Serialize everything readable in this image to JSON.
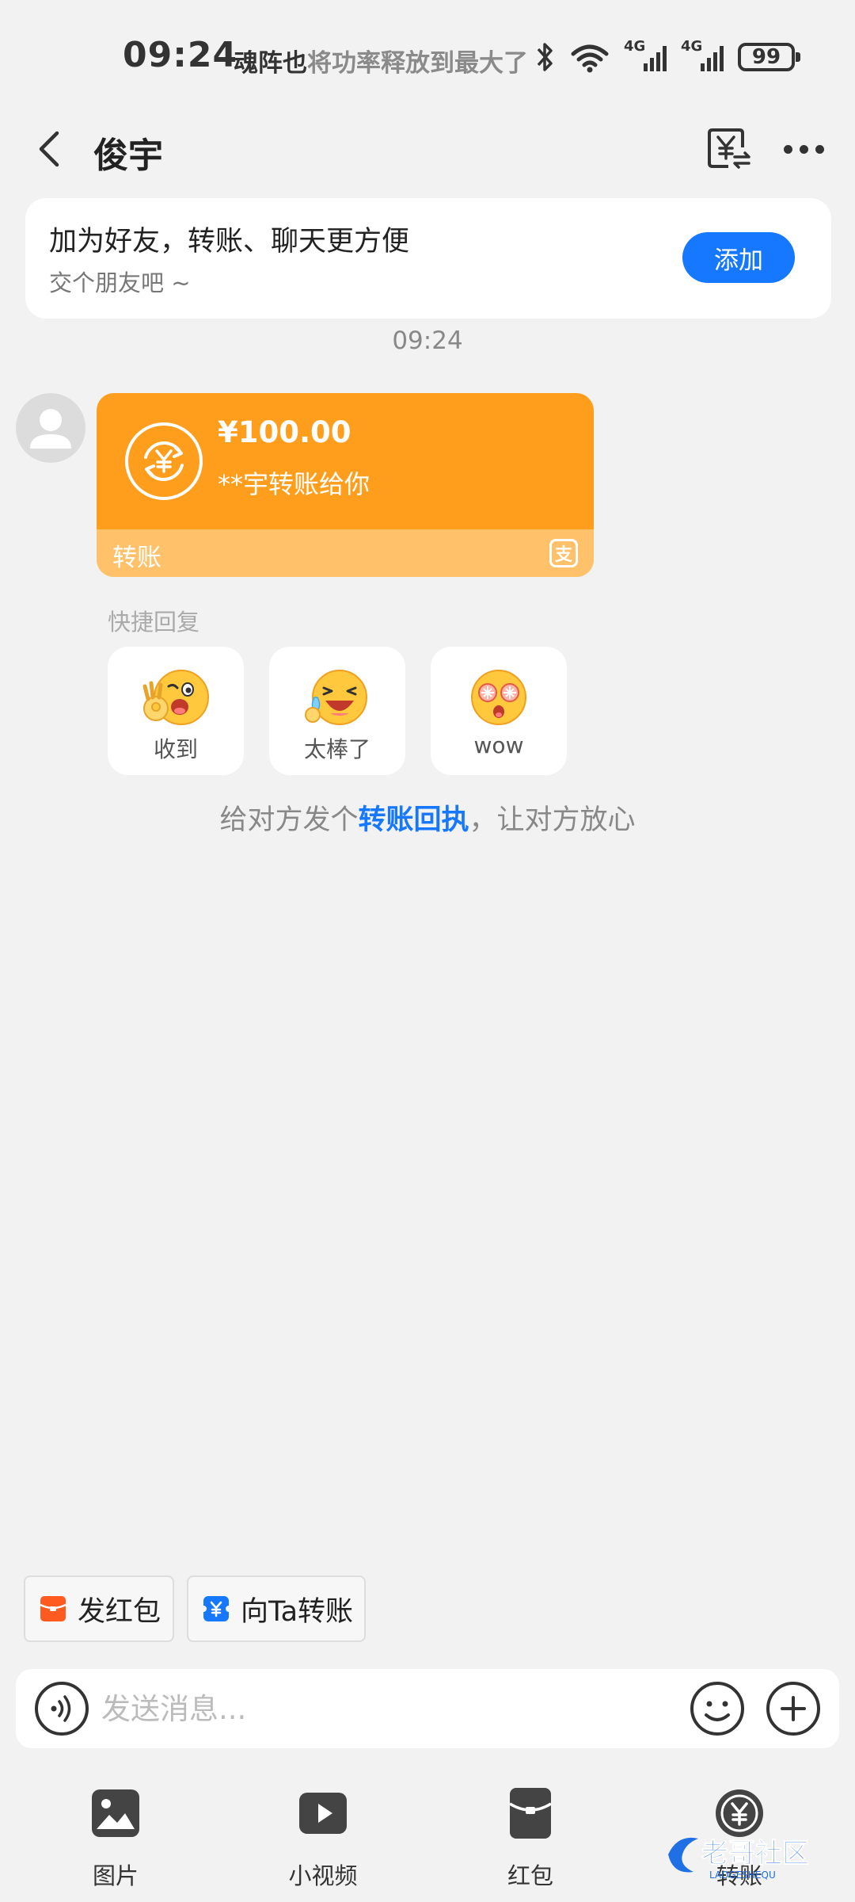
{
  "status_bar": {
    "time": "09:24",
    "notice": "魂阵也将功率释放到最大了",
    "notice_a": "魂阵也",
    "notice_b": "将功率释放到最大了",
    "net1": "4G",
    "net2": "4G",
    "battery": "99"
  },
  "header": {
    "title": "俊宇"
  },
  "friend_banner": {
    "title": "加为好友，转账、聊天更方便",
    "subtitle": "交个朋友吧 ~",
    "add_label": "添加"
  },
  "message_time": "09:24",
  "transfer": {
    "amount": "¥100.00",
    "description": "**宇转账给你",
    "label": "转账",
    "brand_glyph": "支"
  },
  "quick_reply": {
    "label": "快捷回复",
    "items": [
      {
        "label": "收到"
      },
      {
        "label": "太棒了"
      },
      {
        "label": "wow"
      }
    ]
  },
  "receipt_tip": {
    "before": "给对方发个",
    "link": "转账回执",
    "after": "，让对方放心"
  },
  "shortcuts": {
    "red_packet": "发红包",
    "transfer": "向Ta转账"
  },
  "input": {
    "placeholder": "发送消息..."
  },
  "toolbar": {
    "items": [
      {
        "label": "图片"
      },
      {
        "label": "小视频"
      },
      {
        "label": "红包"
      },
      {
        "label": "转账"
      }
    ]
  },
  "watermark": {
    "text": "老哥社区",
    "sub": "LAOGESHEQU"
  },
  "colors": {
    "accent": "#1677ff",
    "transfer_orange": "#ff9e1c",
    "transfer_footer": "#ffc16a",
    "background": "#f2f2f2",
    "red_packet": "#ff5a1f"
  }
}
